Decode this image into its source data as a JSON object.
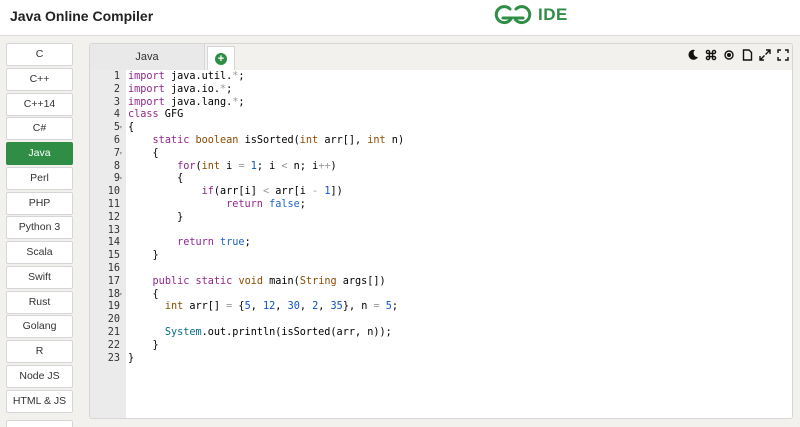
{
  "header": {
    "title": "Java Online Compiler",
    "logo_text": "IDE",
    "brand_color": "#2f8d46"
  },
  "sidebar": {
    "items": [
      {
        "label": "C",
        "active": false
      },
      {
        "label": "C++",
        "active": false
      },
      {
        "label": "C++14",
        "active": false
      },
      {
        "label": "C#",
        "active": false
      },
      {
        "label": "Java",
        "active": true
      },
      {
        "label": "Perl",
        "active": false
      },
      {
        "label": "PHP",
        "active": false
      },
      {
        "label": "Python 3",
        "active": false
      },
      {
        "label": "Scala",
        "active": false
      },
      {
        "label": "Swift",
        "active": false
      },
      {
        "label": "Rust",
        "active": false
      },
      {
        "label": "Golang",
        "active": false
      },
      {
        "label": "R",
        "active": false
      },
      {
        "label": "Node JS",
        "active": false
      },
      {
        "label": "HTML & JS",
        "active": false
      }
    ]
  },
  "editor": {
    "tab_label": "Java",
    "add_tab_symbol": "+",
    "toolbar_icons": [
      "dark-mode-icon",
      "command-icon",
      "settings-icon",
      "file-icon",
      "expand-icon",
      "fullscreen-icon"
    ],
    "line_numbers": [
      "1",
      "2",
      "3",
      "4",
      "5",
      "6",
      "7",
      "8",
      "9",
      "10",
      "11",
      "12",
      "13",
      "14",
      "15",
      "16",
      "17",
      "18",
      "19",
      "20",
      "21",
      "22",
      "23"
    ],
    "fold_marker": "▾",
    "fold_lines": [
      5,
      7,
      9,
      18
    ],
    "code_lines": [
      [
        {
          "t": "kw",
          "v": "import"
        },
        {
          "t": "plain",
          "v": " java.util."
        },
        {
          "t": "op",
          "v": "*"
        },
        {
          "t": "plain",
          "v": ";"
        }
      ],
      [
        {
          "t": "kw",
          "v": "import"
        },
        {
          "t": "plain",
          "v": " java.io."
        },
        {
          "t": "op",
          "v": "*"
        },
        {
          "t": "plain",
          "v": ";"
        }
      ],
      [
        {
          "t": "kw",
          "v": "import"
        },
        {
          "t": "plain",
          "v": " java.lang."
        },
        {
          "t": "op",
          "v": "*"
        },
        {
          "t": "plain",
          "v": ";"
        }
      ],
      [
        {
          "t": "kw",
          "v": "class"
        },
        {
          "t": "plain",
          "v": " GFG"
        }
      ],
      [
        {
          "t": "plain",
          "v": "{"
        }
      ],
      [
        {
          "t": "plain",
          "v": "    "
        },
        {
          "t": "kw",
          "v": "static"
        },
        {
          "t": "plain",
          "v": " "
        },
        {
          "t": "ty",
          "v": "boolean"
        },
        {
          "t": "plain",
          "v": " isSorted("
        },
        {
          "t": "ty",
          "v": "int"
        },
        {
          "t": "plain",
          "v": " arr[], "
        },
        {
          "t": "ty",
          "v": "int"
        },
        {
          "t": "plain",
          "v": " n)"
        }
      ],
      [
        {
          "t": "plain",
          "v": "    {"
        }
      ],
      [
        {
          "t": "plain",
          "v": "        "
        },
        {
          "t": "kw",
          "v": "for"
        },
        {
          "t": "plain",
          "v": "("
        },
        {
          "t": "ty",
          "v": "int"
        },
        {
          "t": "plain",
          "v": " i "
        },
        {
          "t": "op",
          "v": "="
        },
        {
          "t": "plain",
          "v": " "
        },
        {
          "t": "num",
          "v": "1"
        },
        {
          "t": "plain",
          "v": "; i "
        },
        {
          "t": "op",
          "v": "<"
        },
        {
          "t": "plain",
          "v": " n; i"
        },
        {
          "t": "op",
          "v": "++"
        },
        {
          "t": "plain",
          "v": ")"
        }
      ],
      [
        {
          "t": "plain",
          "v": "        {"
        }
      ],
      [
        {
          "t": "plain",
          "v": "            "
        },
        {
          "t": "kw",
          "v": "if"
        },
        {
          "t": "plain",
          "v": "(arr[i] "
        },
        {
          "t": "op",
          "v": "<"
        },
        {
          "t": "plain",
          "v": " arr[i "
        },
        {
          "t": "op",
          "v": "-"
        },
        {
          "t": "plain",
          "v": " "
        },
        {
          "t": "num",
          "v": "1"
        },
        {
          "t": "plain",
          "v": "])"
        }
      ],
      [
        {
          "t": "plain",
          "v": "                "
        },
        {
          "t": "kw",
          "v": "return"
        },
        {
          "t": "plain",
          "v": " "
        },
        {
          "t": "lit",
          "v": "false"
        },
        {
          "t": "plain",
          "v": ";"
        }
      ],
      [
        {
          "t": "plain",
          "v": "        }"
        }
      ],
      [
        {
          "t": "plain",
          "v": ""
        }
      ],
      [
        {
          "t": "plain",
          "v": "        "
        },
        {
          "t": "kw",
          "v": "return"
        },
        {
          "t": "plain",
          "v": " "
        },
        {
          "t": "lit",
          "v": "true"
        },
        {
          "t": "plain",
          "v": ";"
        }
      ],
      [
        {
          "t": "plain",
          "v": "    }"
        }
      ],
      [
        {
          "t": "plain",
          "v": ""
        }
      ],
      [
        {
          "t": "plain",
          "v": "    "
        },
        {
          "t": "kw",
          "v": "public"
        },
        {
          "t": "plain",
          "v": " "
        },
        {
          "t": "kw",
          "v": "static"
        },
        {
          "t": "plain",
          "v": " "
        },
        {
          "t": "ty",
          "v": "void"
        },
        {
          "t": "plain",
          "v": " main("
        },
        {
          "t": "ty",
          "v": "String"
        },
        {
          "t": "plain",
          "v": " args[])"
        }
      ],
      [
        {
          "t": "plain",
          "v": "    {"
        }
      ],
      [
        {
          "t": "plain",
          "v": "      "
        },
        {
          "t": "ty",
          "v": "int"
        },
        {
          "t": "plain",
          "v": " arr[] "
        },
        {
          "t": "op",
          "v": "="
        },
        {
          "t": "plain",
          "v": " {"
        },
        {
          "t": "num",
          "v": "5"
        },
        {
          "t": "plain",
          "v": ", "
        },
        {
          "t": "num",
          "v": "12"
        },
        {
          "t": "plain",
          "v": ", "
        },
        {
          "t": "num",
          "v": "30"
        },
        {
          "t": "plain",
          "v": ", "
        },
        {
          "t": "num",
          "v": "2"
        },
        {
          "t": "plain",
          "v": ", "
        },
        {
          "t": "num",
          "v": "35"
        },
        {
          "t": "plain",
          "v": "}, n "
        },
        {
          "t": "op",
          "v": "="
        },
        {
          "t": "plain",
          "v": " "
        },
        {
          "t": "num",
          "v": "5"
        },
        {
          "t": "plain",
          "v": ";"
        }
      ],
      [
        {
          "t": "plain",
          "v": ""
        }
      ],
      [
        {
          "t": "plain",
          "v": "      "
        },
        {
          "t": "cls",
          "v": "System"
        },
        {
          "t": "plain",
          "v": ".out.println(isSorted(arr, n));"
        }
      ],
      [
        {
          "t": "plain",
          "v": "    }"
        }
      ],
      [
        {
          "t": "plain",
          "v": "}"
        }
      ]
    ]
  }
}
